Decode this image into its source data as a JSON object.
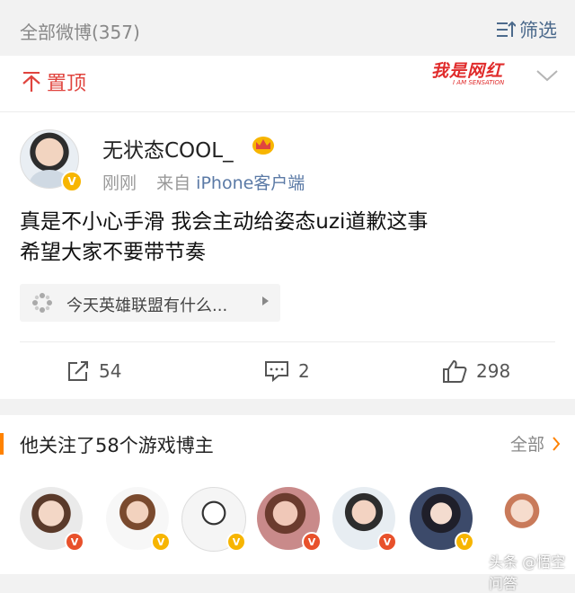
{
  "header": {
    "all_label": "全部微博(357)",
    "filter_label": "筛选"
  },
  "pinned": {
    "label": "置顶",
    "brand_logo": "我是网红",
    "brand_sub": "I AM SENSATION"
  },
  "post": {
    "username": "无状态COOL_",
    "time": "刚刚",
    "from_prefix": "来自",
    "source": "iPhone客户端",
    "text_line1": "真是不小心手滑 我会主动给姿态uzi道歉这事",
    "text_line2": "希望大家不要带节奏",
    "topic": "今天英雄联盟有什么...",
    "repost_count": "54",
    "comment_count": "2",
    "like_count": "298"
  },
  "follow": {
    "title": "他关注了58个游戏博主",
    "all_label": "全部"
  },
  "watermark": "头条 @悟空问答",
  "colors": {
    "accent_red": "#e0443e",
    "link_blue": "#5b7aa6",
    "orange": "#ff8200",
    "gold": "#f7b500"
  }
}
